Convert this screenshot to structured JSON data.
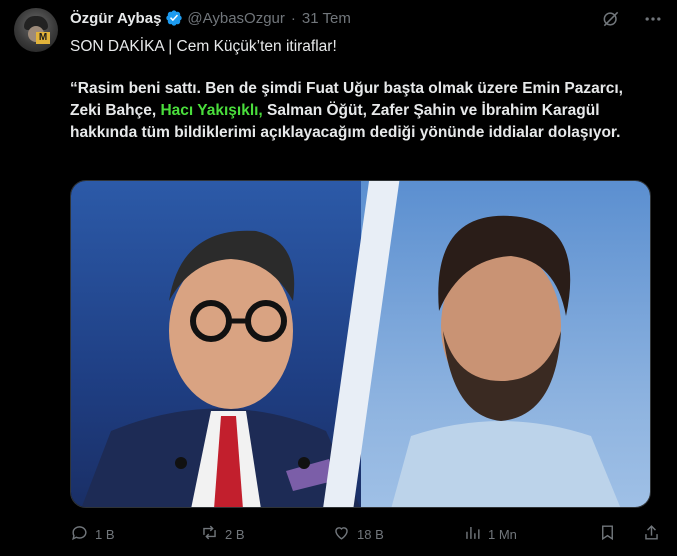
{
  "author": {
    "display_name": "Özgür Aybaş",
    "handle": "@AybasOzgur",
    "separator": "·",
    "time": "31 Tem",
    "verified": true,
    "avatar_letter": "M"
  },
  "post": {
    "line1": "SON DAKİKA | Cem Küçük’ten itiraflar!",
    "quote_part1": "“Rasim beni sattı. Ben de şimdi Fuat Uğur başta olmak üzere Emin Pazarcı, Zeki Bahçe, ",
    "quote_highlight": "Hacı Yakışıklı,",
    "quote_part2": " Salman Öğüt, Zafer Şahin ve İbrahim Karagül hakkında tüm bildiklerimi açıklayacağım dediği yönünde iddialar dolaşıyor."
  },
  "actions": {
    "reply_count": "1 B",
    "repost_count": "2 B",
    "like_count": "18 B",
    "view_count": "1 Mn"
  },
  "colors": {
    "background": "#000000",
    "text": "#e7e9ea",
    "muted": "#71767b",
    "verified": "#1d9bf0",
    "highlight": "#4ade3c"
  },
  "icons": {
    "verified": "verified-badge-icon",
    "grok": "grok-icon",
    "more": "more-options-icon",
    "reply": "reply-icon",
    "repost": "repost-icon",
    "like": "like-icon",
    "views": "views-icon",
    "bookmark": "bookmark-icon",
    "share": "share-icon"
  }
}
